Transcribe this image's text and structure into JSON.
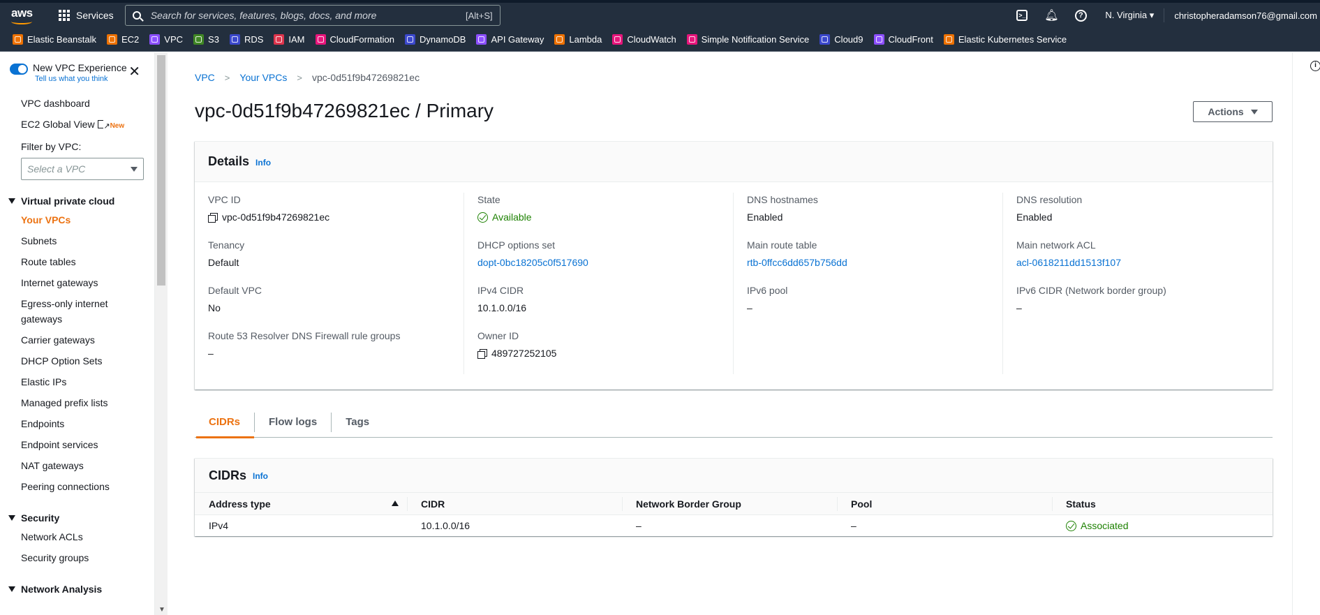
{
  "nav": {
    "logo": "aws",
    "services_label": "Services",
    "search_placeholder": "Search for services, features, blogs, docs, and more",
    "search_shortcut": "[Alt+S]",
    "region": "N. Virginia",
    "account": "christopheradamson76@gmail.com"
  },
  "favorites": [
    {
      "label": "Elastic Beanstalk",
      "color": "#ed7100"
    },
    {
      "label": "EC2",
      "color": "#ed7100"
    },
    {
      "label": "VPC",
      "color": "#8c4fff"
    },
    {
      "label": "S3",
      "color": "#3f8624"
    },
    {
      "label": "RDS",
      "color": "#3b48cc"
    },
    {
      "label": "IAM",
      "color": "#dd344c"
    },
    {
      "label": "CloudFormation",
      "color": "#e7157b"
    },
    {
      "label": "DynamoDB",
      "color": "#3b48cc"
    },
    {
      "label": "API Gateway",
      "color": "#8c4fff"
    },
    {
      "label": "Lambda",
      "color": "#ed7100"
    },
    {
      "label": "CloudWatch",
      "color": "#e7157b"
    },
    {
      "label": "Simple Notification Service",
      "color": "#e7157b"
    },
    {
      "label": "Cloud9",
      "color": "#3b48cc"
    },
    {
      "label": "CloudFront",
      "color": "#8c4fff"
    },
    {
      "label": "Elastic Kubernetes Service",
      "color": "#ed7100"
    }
  ],
  "sidebar": {
    "toggle_label": "New VPC Experience",
    "toggle_sub": "Tell us what you think",
    "vpc_dashboard": "VPC dashboard",
    "ec2_global_view": "EC2 Global View",
    "new_badge": "New",
    "filter_label": "Filter by VPC:",
    "filter_placeholder": "Select a VPC",
    "section_vpc": "Virtual private cloud",
    "vpc_items": [
      "Your VPCs",
      "Subnets",
      "Route tables",
      "Internet gateways",
      "Egress-only internet gateways",
      "Carrier gateways",
      "DHCP Option Sets",
      "Elastic IPs",
      "Managed prefix lists",
      "Endpoints",
      "Endpoint services",
      "NAT gateways",
      "Peering connections"
    ],
    "section_security": "Security",
    "security_items": [
      "Network ACLs",
      "Security groups"
    ],
    "section_network": "Network Analysis"
  },
  "breadcrumb": {
    "root": "VPC",
    "parent": "Your VPCs",
    "current": "vpc-0d51f9b47269821ec"
  },
  "page_title": "vpc-0d51f9b47269821ec / Primary",
  "actions_label": "Actions",
  "details": {
    "title": "Details",
    "info": "Info",
    "col1": [
      {
        "k": "VPC ID",
        "v": "vpc-0d51f9b47269821ec"
      },
      {
        "k": "Tenancy",
        "v": "Default"
      },
      {
        "k": "Default VPC",
        "v": "No"
      },
      {
        "k": "Route 53 Resolver DNS Firewall rule groups",
        "v": "–"
      }
    ],
    "col2": [
      {
        "k": "State",
        "v": "Available"
      },
      {
        "k": "DHCP options set",
        "v": "dopt-0bc18205c0f517690"
      },
      {
        "k": "IPv4 CIDR",
        "v": "10.1.0.0/16"
      },
      {
        "k": "Owner ID",
        "v": "489727252105"
      }
    ],
    "col3": [
      {
        "k": "DNS hostnames",
        "v": "Enabled"
      },
      {
        "k": "Main route table",
        "v": "rtb-0ffcc6dd657b756dd"
      },
      {
        "k": "IPv6 pool",
        "v": "–"
      }
    ],
    "col4": [
      {
        "k": "DNS resolution",
        "v": "Enabled"
      },
      {
        "k": "Main network ACL",
        "v": "acl-0618211dd1513f107"
      },
      {
        "k": "IPv6 CIDR (Network border group)",
        "v": "–"
      }
    ]
  },
  "tabs": [
    "CIDRs",
    "Flow logs",
    "Tags"
  ],
  "cidrs": {
    "title": "CIDRs",
    "info": "Info",
    "columns": [
      "Address type",
      "CIDR",
      "Network Border Group",
      "Pool",
      "Status"
    ],
    "rows": [
      {
        "type": "IPv4",
        "cidr": "10.1.0.0/16",
        "nbg": "–",
        "pool": "–",
        "status": "Associated"
      }
    ]
  }
}
